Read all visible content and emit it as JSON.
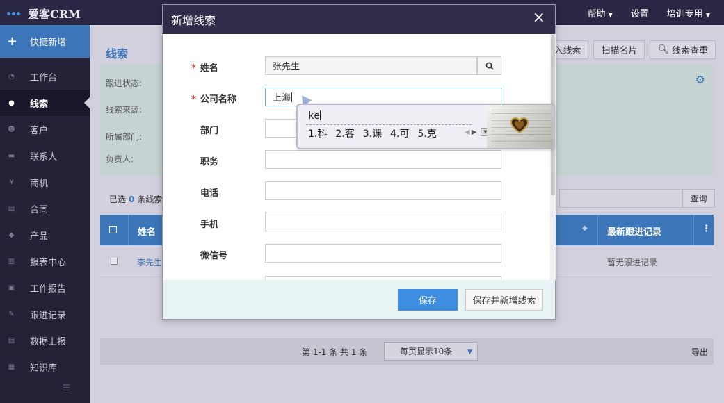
{
  "app": {
    "logo_text": "爱客CRM"
  },
  "topnav": {
    "help": "帮助",
    "settings": "设置",
    "user": "培训专用"
  },
  "sidebar": {
    "quick_add": "快捷新增",
    "items": [
      {
        "label": "工作台",
        "icon": "dashboard-icon"
      },
      {
        "label": "线索",
        "icon": "globe-icon"
      },
      {
        "label": "客户",
        "icon": "users-icon"
      },
      {
        "label": "联系人",
        "icon": "chat-icon"
      },
      {
        "label": "商机",
        "icon": "yen-icon"
      },
      {
        "label": "合同",
        "icon": "document-icon"
      },
      {
        "label": "产品",
        "icon": "tag-icon"
      },
      {
        "label": "报表中心",
        "icon": "bar-chart-icon"
      },
      {
        "label": "工作报告",
        "icon": "report-icon"
      },
      {
        "label": "跟进记录",
        "icon": "edit-icon"
      },
      {
        "label": "数据上报",
        "icon": "upload-icon"
      },
      {
        "label": "知识库",
        "icon": "book-icon"
      }
    ],
    "active_index": 1
  },
  "page": {
    "title": "线索",
    "buttons": {
      "import": "导入线索",
      "scan_card": "扫描名片",
      "check": "线索查重"
    },
    "filters": {
      "status": "跟进状态:",
      "source": "线索来源:",
      "department": "所属部门:",
      "owner": "负责人:"
    },
    "selected_prefix": "已选",
    "selected_count": "0",
    "selected_suffix": "条线索",
    "search_button": "查询",
    "table": {
      "col_name": "姓名",
      "col_latest": "最新跟进记录",
      "rows": [
        {
          "name": "李先生",
          "latest": "暂无跟进记录"
        }
      ]
    },
    "pager": {
      "summary": "第 1-1 条 共 1 条",
      "page_size": "每页显示10条",
      "export": "导出"
    }
  },
  "modal": {
    "title": "新增线索",
    "fields": [
      {
        "label": "姓名",
        "required": true,
        "value": "张先生",
        "has_search": true
      },
      {
        "label": "公司名称",
        "required": true,
        "value": "上海",
        "focused": true
      },
      {
        "label": "部门",
        "required": false,
        "value": ""
      },
      {
        "label": "职务",
        "required": false,
        "value": ""
      },
      {
        "label": "电话",
        "required": false,
        "value": ""
      },
      {
        "label": "手机",
        "required": false,
        "value": ""
      },
      {
        "label": "微信号",
        "required": false,
        "value": ""
      }
    ],
    "required_mark": "*",
    "save": "保存",
    "save_and_new": "保存并新增线索"
  },
  "ime": {
    "composition": "ke",
    "candidates": [
      "1.科",
      "2.客",
      "3.课",
      "4.可",
      "5.克"
    ]
  },
  "colors": {
    "brand_blue": "#3d76b8",
    "topbar": "#2a2845",
    "sidebar": "#232237",
    "required": "#d9534f"
  }
}
